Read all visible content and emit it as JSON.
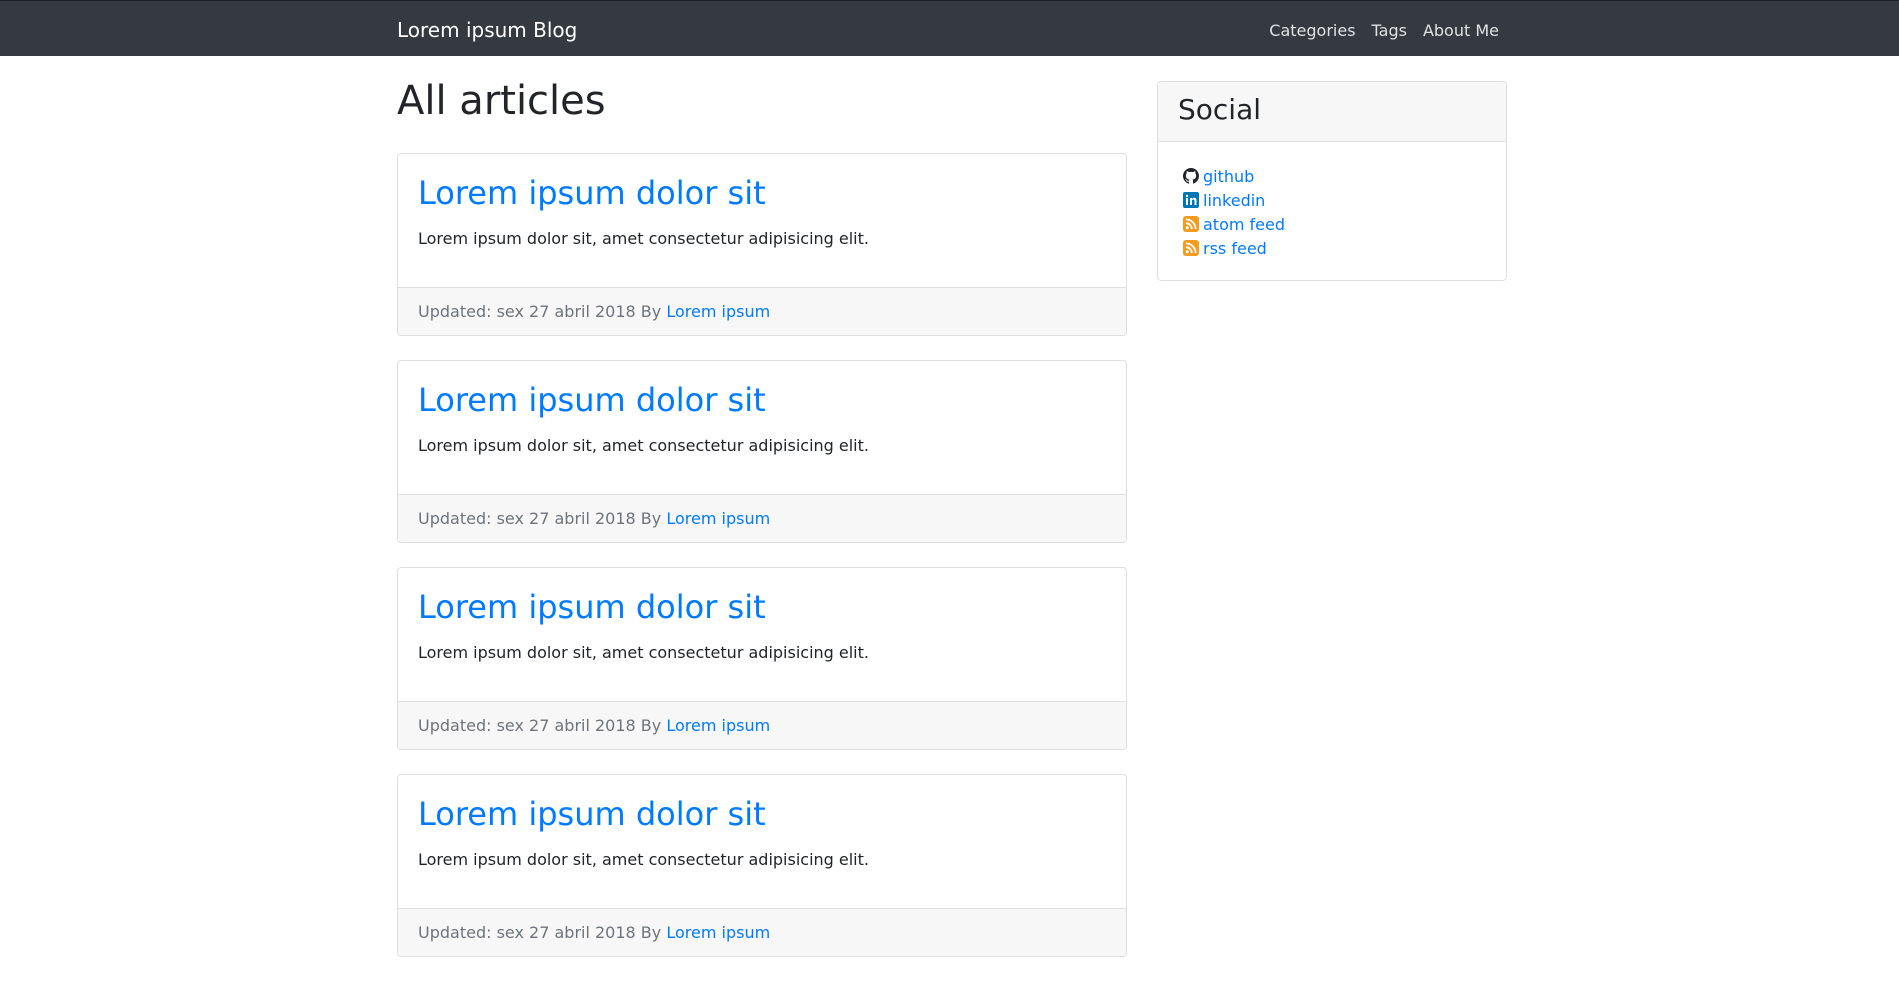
{
  "navbar": {
    "brand": "Lorem ipsum Blog",
    "links": [
      {
        "label": "Categories"
      },
      {
        "label": "Tags"
      },
      {
        "label": "About Me"
      }
    ]
  },
  "main": {
    "title": "All articles",
    "articles": [
      {
        "title": "Lorem ipsum dolor sit",
        "summary": "Lorem ipsum dolor sit, amet consectetur adipisicing elit.",
        "updated_prefix": "Updated: sex 27 abril 2018 By",
        "author": "Lorem ipsum"
      },
      {
        "title": "Lorem ipsum dolor sit",
        "summary": "Lorem ipsum dolor sit, amet consectetur adipisicing elit.",
        "updated_prefix": "Updated: sex 27 abril 2018 By",
        "author": "Lorem ipsum"
      },
      {
        "title": "Lorem ipsum dolor sit",
        "summary": "Lorem ipsum dolor sit, amet consectetur adipisicing elit.",
        "updated_prefix": "Updated: sex 27 abril 2018 By",
        "author": "Lorem ipsum"
      },
      {
        "title": "Lorem ipsum dolor sit",
        "summary": "Lorem ipsum dolor sit, amet consectetur adipisicing elit.",
        "updated_prefix": "Updated: sex 27 abril 2018 By",
        "author": "Lorem ipsum"
      }
    ]
  },
  "sidebar": {
    "title": "Social",
    "links": [
      {
        "label": "github",
        "icon": "github-icon"
      },
      {
        "label": "linkedin",
        "icon": "linkedin-icon"
      },
      {
        "label": "atom feed",
        "icon": "feed-icon"
      },
      {
        "label": "rss feed",
        "icon": "feed-icon"
      }
    ]
  },
  "colors": {
    "navbar_bg": "#343a40",
    "link": "#007bff",
    "card_footer_bg": "#f7f7f7",
    "muted_text": "#6c757d",
    "feed_orange": "#f39c1f",
    "linkedin_blue": "#0077b5"
  }
}
